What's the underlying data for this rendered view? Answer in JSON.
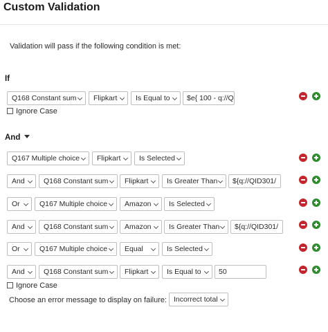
{
  "title": "Custom Validation",
  "description": "Validation will pass if the following condition is met:",
  "if_label": "If",
  "and_label": "And",
  "ignore_case_label": "Ignore Case",
  "rows": [
    {
      "conjunction": "",
      "question": "Q168 Constant sum",
      "choice": "Flipkart",
      "operator": "Is Equal to",
      "value": "$e{ 100 - q://Q"
    },
    {
      "conjunction": "",
      "question": "Q167 Multiple choice",
      "choice": "Flipkart",
      "operator": "Is Selected",
      "value": ""
    },
    {
      "conjunction": "And",
      "question": "Q168 Constant sum",
      "choice": "Flipkart",
      "operator": "Is Greater Than",
      "value": "${q://QID301/"
    },
    {
      "conjunction": "Or",
      "question": "Q167 Multiple choice",
      "choice": "Amazon",
      "operator": "Is Selected",
      "value": ""
    },
    {
      "conjunction": "And",
      "question": "Q168 Constant sum",
      "choice": "Amazon",
      "operator": "Is Greater Than",
      "value": "${q://QID301/"
    },
    {
      "conjunction": "Or",
      "question": "Q167 Multiple choice",
      "choice": "Equal",
      "operator": "Is Selected",
      "value": ""
    },
    {
      "conjunction": "And",
      "question": "Q168 Constant sum",
      "choice": "Flipkart",
      "operator": "Is Equal to",
      "value": "50"
    }
  ],
  "error_prompt": "Choose an error message to display on failure:",
  "error_message": "Incorrect total",
  "colors": {
    "remove": "#c4262e",
    "add": "#2e8b2e"
  }
}
